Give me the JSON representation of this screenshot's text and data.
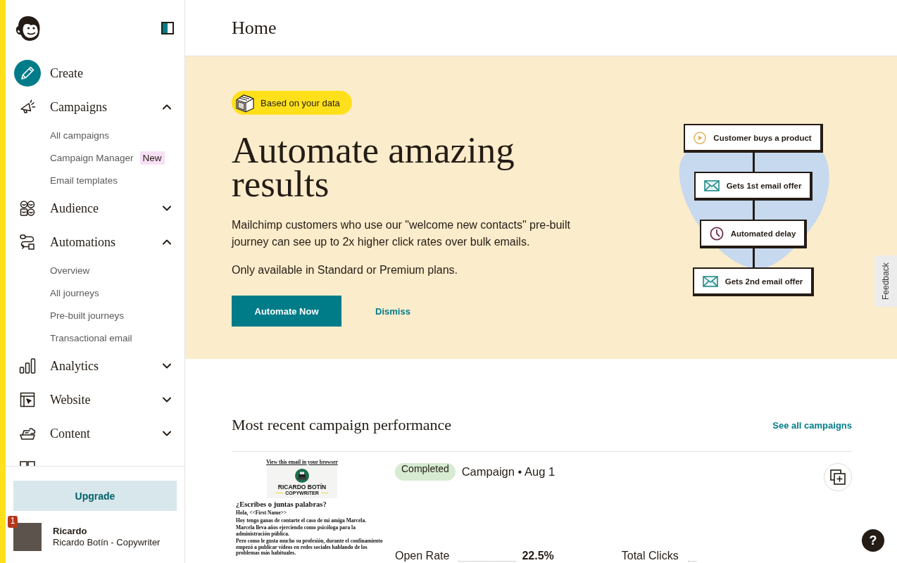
{
  "sidebar": {
    "create": "Create",
    "nav": [
      {
        "label": "Campaigns",
        "expanded": true,
        "children": [
          {
            "label": "All campaigns"
          },
          {
            "label": "Campaign Manager",
            "badge": "New"
          },
          {
            "label": "Email templates"
          }
        ]
      },
      {
        "label": "Audience",
        "expanded": false
      },
      {
        "label": "Automations",
        "expanded": true,
        "children": [
          {
            "label": "Overview"
          },
          {
            "label": "All journeys"
          },
          {
            "label": "Pre-built journeys"
          },
          {
            "label": "Transactional email"
          }
        ]
      },
      {
        "label": "Analytics",
        "expanded": false
      },
      {
        "label": "Website",
        "expanded": false
      },
      {
        "label": "Content",
        "expanded": false
      }
    ],
    "upgrade_button": "Upgrade",
    "account": {
      "name": "Ricardo",
      "subtitle": "Ricardo Botín - Copywriter",
      "notification_count": "1"
    }
  },
  "header": {
    "title": "Home"
  },
  "hero": {
    "tag": "Based on your data",
    "title": "Automate amazing results",
    "body": "Mailchimp customers who use our \"welcome new contacts\" pre-built journey can see up to 2x higher click rates over bulk emails.",
    "note": "Only available in Standard or Premium plans.",
    "primary_button": "Automate Now",
    "secondary_button": "Dismiss",
    "journey": [
      {
        "kind": "trigger",
        "label": "Customer buys a product"
      },
      {
        "kind": "email",
        "label": "Gets 1st email offer"
      },
      {
        "kind": "delay",
        "label": "Automated delay"
      },
      {
        "kind": "email",
        "label": "Gets 2nd email offer"
      }
    ]
  },
  "recent_campaigns": {
    "title": "Most recent campaign performance",
    "link": "See all campaigns",
    "campaign": {
      "status": "Completed",
      "title": "Campaign • Aug 1",
      "preview": {
        "browser_link": "View this email in your browser",
        "brand_name": "RICARDO BOTÍN",
        "brand_tagline": "COPYWRITER",
        "heading": "¿Escribes o juntas palabras?",
        "paragraphs": [
          "Hola, <<First Name>>",
          "Hoy tengo ganas de contarte el caso de mi amiga Marcela.",
          "Marcela lleva años ejerciendo como psicóloga para la administración pública.",
          "Pero como le gusta mucho su profesión, durante el confinamiento empezó a publicar vídeos en redes sociales hablando de los problemas más habituales."
        ]
      },
      "stats": [
        {
          "label": "Open Rate",
          "value": "22.5%"
        },
        {
          "label": "Total Clicks"
        }
      ]
    }
  },
  "feedback_tab": "Feedback",
  "help_button": "?"
}
